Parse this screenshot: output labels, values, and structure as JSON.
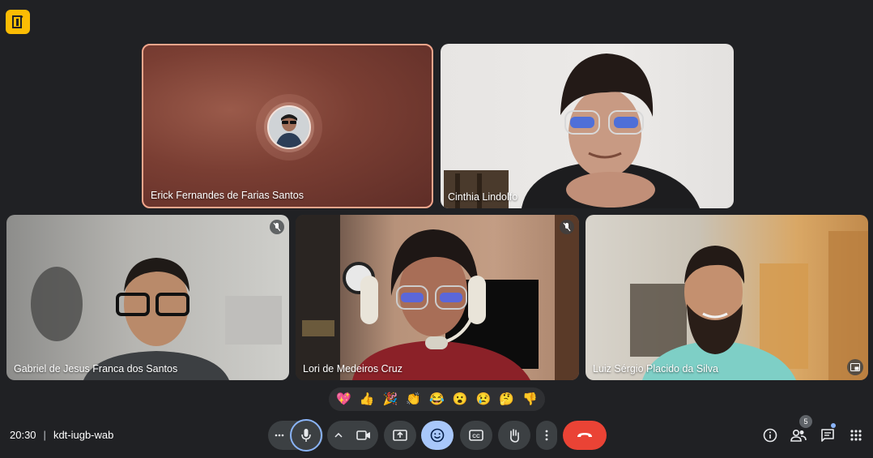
{
  "meeting": {
    "time": "20:30",
    "separator": "|",
    "code": "kdt-iugb-wab"
  },
  "participants": [
    {
      "name": "Erick Fernandes de Farias Santos",
      "speaking": true,
      "camera": false
    },
    {
      "name": "Cinthia Lindolfo",
      "muted": false
    },
    {
      "name": "Gabriel de Jesus Franca dos Santos",
      "muted": true
    },
    {
      "name": "Lori de Medeiros Cruz",
      "muted": true
    },
    {
      "name": "Luiz Sérgio Placido da Silva",
      "muted": false
    }
  ],
  "reactions": [
    "💖",
    "👍",
    "🎉",
    "👏",
    "😂",
    "😮",
    "😢",
    "🤔",
    "👎"
  ],
  "toolbar": {
    "people_count": "5",
    "icons": [
      "more-options-icon",
      "microphone-icon",
      "chevron-up-icon",
      "camera-icon",
      "present-screen-icon",
      "emoji-icon",
      "captions-icon",
      "raise-hand-icon",
      "more-vert-icon",
      "hang-up-icon",
      "info-icon",
      "people-icon",
      "chat-icon",
      "activities-icon"
    ]
  },
  "colors": {
    "background": "#202124",
    "active_speaker_border": "#f4a68c",
    "emoji_active": "#a8c7fa",
    "leave": "#ea4335",
    "logo": "#fbbc04"
  }
}
